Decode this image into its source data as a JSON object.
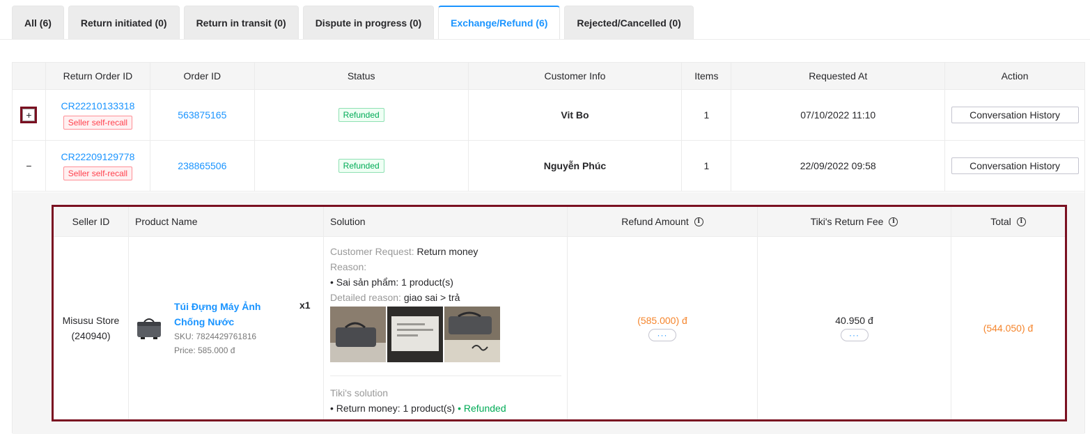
{
  "tabs": [
    {
      "label": "All (6)",
      "active": false
    },
    {
      "label": "Return initiated (0)",
      "active": false
    },
    {
      "label": "Return in transit (0)",
      "active": false
    },
    {
      "label": "Dispute in progress (0)",
      "active": false
    },
    {
      "label": "Exchange/Refund (6)",
      "active": true
    },
    {
      "label": "Rejected/Cancelled (0)",
      "active": false
    }
  ],
  "table": {
    "headers": [
      "",
      "Return Order ID",
      "Order ID",
      "Status",
      "Customer Info",
      "Items",
      "Requested At",
      "Action"
    ],
    "rows": [
      {
        "expander": "+",
        "return_id": "CR22210133318",
        "recall": "Seller self-recall",
        "order_id": "563875165",
        "status": "Refunded",
        "customer": "Vit Bo",
        "items": "1",
        "requested_at": "07/10/2022 11:10",
        "action": "Conversation History"
      },
      {
        "expander": "−",
        "return_id": "CR22209129778",
        "recall": "Seller self-recall",
        "order_id": "238865506",
        "status": "Refunded",
        "customer": "Nguyễn Phúc",
        "items": "1",
        "requested_at": "22/09/2022 09:58",
        "action": "Conversation History"
      }
    ]
  },
  "detail": {
    "headers": {
      "seller": "Seller ID",
      "product": "Product Name",
      "solution": "Solution",
      "refund": "Refund Amount",
      "fee": "Tiki's Return Fee",
      "total": "Total"
    },
    "seller_name": "Misusu Store",
    "seller_id": "(240940)",
    "product": {
      "name": "Túi Đựng Máy Ảnh Chống Nước",
      "sku": "SKU: 7824429761816",
      "price": "Price: 585.000 đ",
      "qty": "x1"
    },
    "solution": {
      "request_label": "Customer Request:",
      "request_value": " Return money",
      "reason_label": "Reason:",
      "reason_item": "• Sai sản phẩm: 1 product(s)",
      "detailed_label": "Detailed reason:",
      "detailed_value": " giao sai > trả",
      "tiki_label": "Tiki's solution",
      "tiki_item": "• Return money: 1 product(s)",
      "tiki_status": " • Refunded"
    },
    "refund_amount": "(585.000) đ",
    "return_fee": "40.950 đ",
    "total": "(544.050) đ",
    "more": "···"
  },
  "colors": {
    "accent": "#1a94ff",
    "highlight_border": "#7a1021",
    "negative": "#f5852c",
    "success": "#00ab56"
  }
}
